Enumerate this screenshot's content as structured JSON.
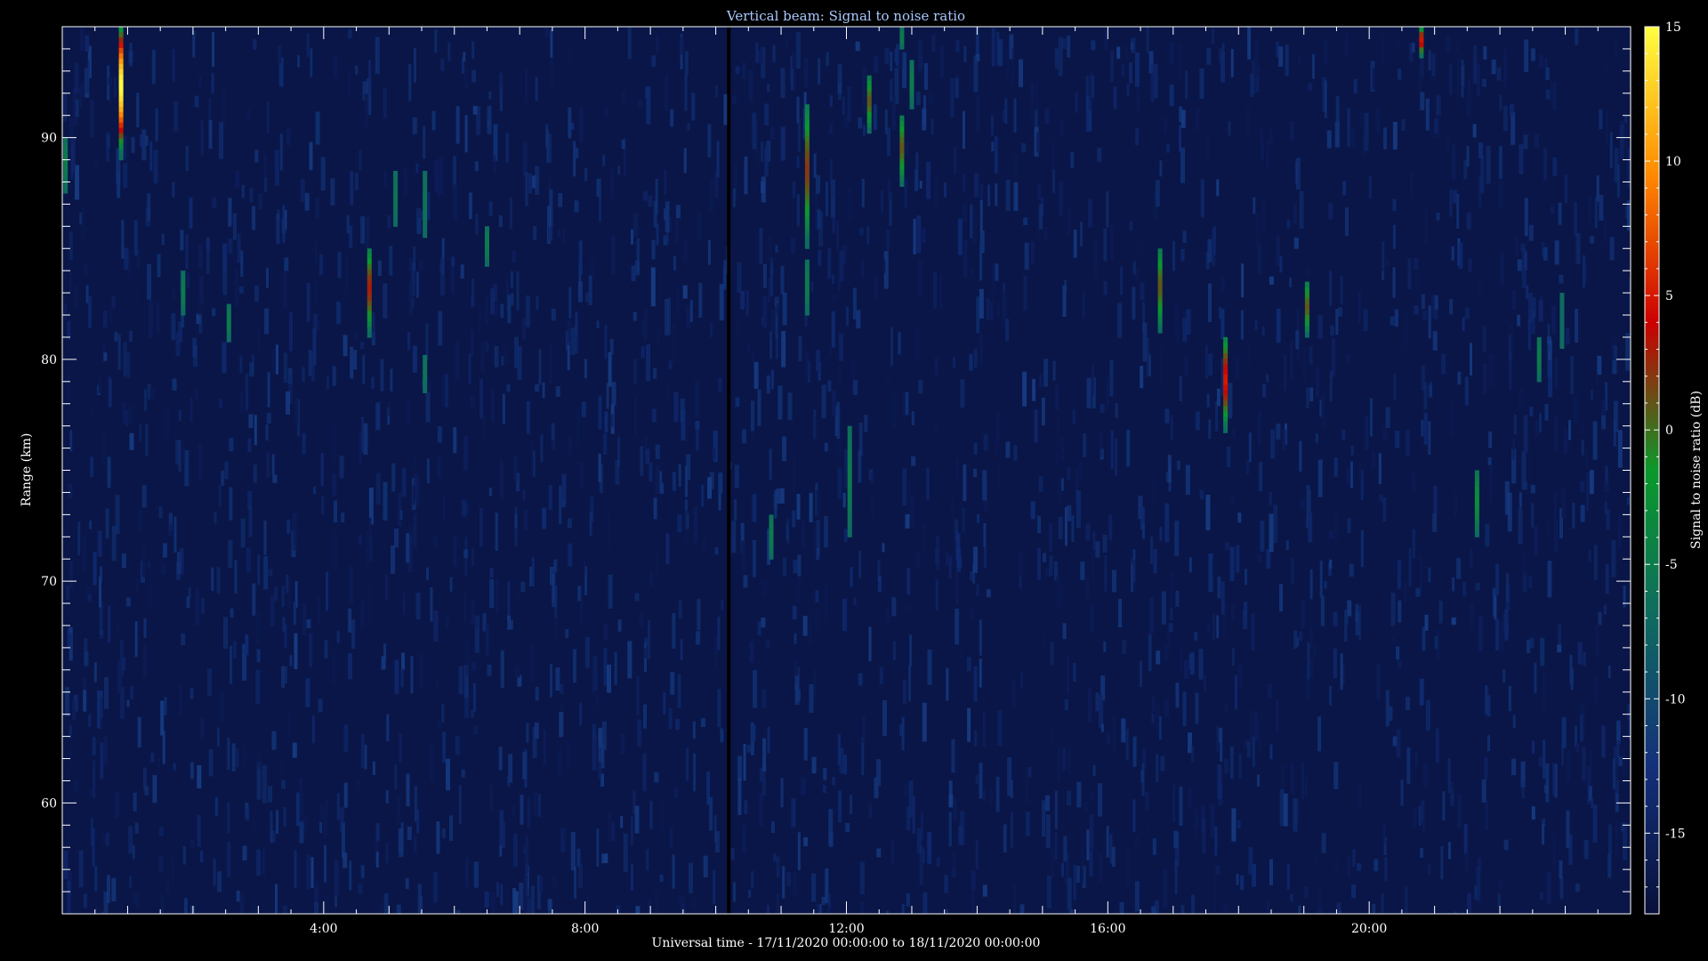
{
  "chart_data": {
    "type": "heatmap",
    "title": "Vertical beam: Signal to noise ratio",
    "xlabel": "Universal time - 17/11/2020 00:00:00 to 18/11/2020 00:00:00",
    "ylabel": "Range (km)",
    "colorbar_label": "Signal to noise ratio (dB)",
    "x_unit": "hours UT",
    "xlim": [
      0,
      24
    ],
    "ylim": [
      55,
      95
    ],
    "x_major_ticks": [
      4,
      8,
      12,
      16,
      20
    ],
    "x_tick_labels": [
      "4:00",
      "8:00",
      "12:00",
      "16:00",
      "20:00"
    ],
    "y_major_ticks": [
      60,
      70,
      80,
      90
    ],
    "y_tick_labels": [
      "60",
      "70",
      "80",
      "90"
    ],
    "colorbar_range": [
      -18,
      15
    ],
    "colorbar_ticks": [
      -15,
      -10,
      -5,
      0,
      5,
      10,
      15
    ],
    "colorbar_tick_labels": [
      "-15",
      "-10",
      "-5",
      "0",
      "5",
      "10",
      "15"
    ],
    "colormap": [
      "#08103a",
      "#14307a",
      "#0f6a60",
      "#0a9a2a",
      "#cc0000",
      "#ff8a00",
      "#ffff40"
    ],
    "data_gap": {
      "x": 10.2
    },
    "echoes": [
      {
        "x": 0.05,
        "y_top": 90,
        "y_bottom": 87.5,
        "peak_snr": -5
      },
      {
        "x": 0.9,
        "y_top": 95,
        "y_bottom": 89,
        "peak_snr": 15
      },
      {
        "x": 1.85,
        "y_top": 84,
        "y_bottom": 82,
        "peak_snr": -5
      },
      {
        "x": 2.55,
        "y_top": 82.5,
        "y_bottom": 80.8,
        "peak_snr": -5
      },
      {
        "x": 4.7,
        "y_top": 85,
        "y_bottom": 81,
        "peak_snr": 3
      },
      {
        "x": 5.1,
        "y_top": 88.5,
        "y_bottom": 86,
        "peak_snr": -6
      },
      {
        "x": 5.55,
        "y_top": 88.5,
        "y_bottom": 85.5,
        "peak_snr": -6
      },
      {
        "x": 5.55,
        "y_top": 80.2,
        "y_bottom": 78.5,
        "peak_snr": -6
      },
      {
        "x": 6.5,
        "y_top": 86,
        "y_bottom": 84.2,
        "peak_snr": -5
      },
      {
        "x": 10.85,
        "y_top": 73,
        "y_bottom": 71,
        "peak_snr": -5
      },
      {
        "x": 11.4,
        "y_top": 91.5,
        "y_bottom": 85,
        "peak_snr": 2
      },
      {
        "x": 11.4,
        "y_top": 84.5,
        "y_bottom": 82,
        "peak_snr": -5
      },
      {
        "x": 12.05,
        "y_top": 77,
        "y_bottom": 72,
        "peak_snr": -5
      },
      {
        "x": 12.35,
        "y_top": 92.8,
        "y_bottom": 90.2,
        "peak_snr": 1
      },
      {
        "x": 12.85,
        "y_top": 91,
        "y_bottom": 87.8,
        "peak_snr": 1
      },
      {
        "x": 12.85,
        "y_top": 95,
        "y_bottom": 94,
        "peak_snr": -5
      },
      {
        "x": 13.0,
        "y_top": 93.5,
        "y_bottom": 91.3,
        "peak_snr": -5
      },
      {
        "x": 16.8,
        "y_top": 85,
        "y_bottom": 81.2,
        "peak_snr": 1
      },
      {
        "x": 17.8,
        "y_top": 81,
        "y_bottom": 76.7,
        "peak_snr": 5
      },
      {
        "x": 19.05,
        "y_top": 83.5,
        "y_bottom": 81,
        "peak_snr": 1
      },
      {
        "x": 20.8,
        "y_top": 95,
        "y_bottom": 93.6,
        "peak_snr": 5
      },
      {
        "x": 21.65,
        "y_top": 75,
        "y_bottom": 72,
        "peak_snr": -3
      },
      {
        "x": 22.6,
        "y_top": 81,
        "y_bottom": 79,
        "peak_snr": -5
      },
      {
        "x": 22.95,
        "y_top": 83,
        "y_bottom": 80.5,
        "peak_snr": -7
      }
    ]
  }
}
